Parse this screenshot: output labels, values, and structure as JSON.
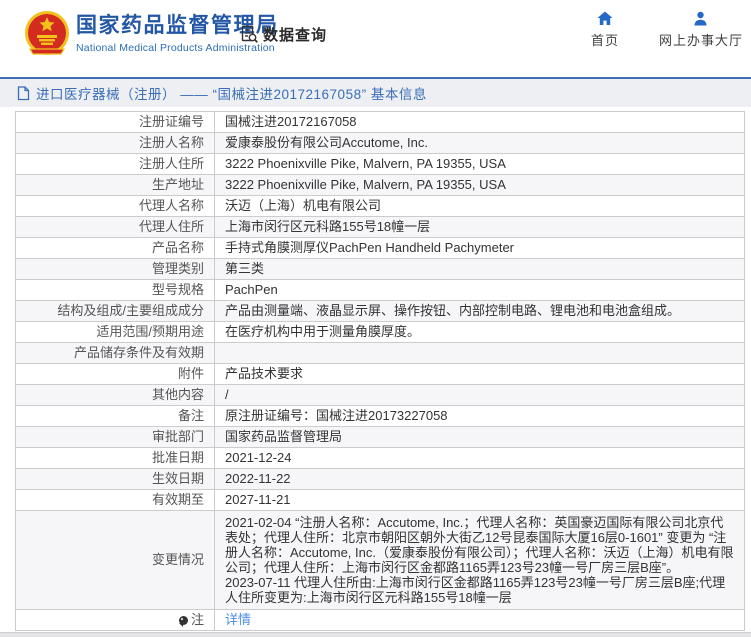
{
  "header": {
    "agency_name_cn": "国家药品监督管理局",
    "agency_name_en": "National Medical Products Administration",
    "data_query_label": "数据查询",
    "nav": [
      {
        "label": "首页",
        "icon": "home-icon"
      },
      {
        "label": "网上办事大厅",
        "icon": "person-icon"
      }
    ]
  },
  "breadcrumb": {
    "text": "进口医疗器械（注册） —— “国械注进20172167058” 基本信息",
    "icon": "page-icon"
  },
  "table": {
    "rows": [
      {
        "label": "注册证编号",
        "value": "国械注进20172167058"
      },
      {
        "label": "注册人名称",
        "value": "爱康泰股份有限公司Accutome, Inc."
      },
      {
        "label": "注册人住所",
        "value": "3222 Phoenixville Pike, Malvern, PA 19355, USA"
      },
      {
        "label": "生产地址",
        "value": "3222 Phoenixville Pike, Malvern, PA 19355, USA"
      },
      {
        "label": "代理人名称",
        "value": "沃迈（上海）机电有限公司"
      },
      {
        "label": "代理人住所",
        "value": "上海市闵行区元科路155号18幢一层"
      },
      {
        "label": "产品名称",
        "value": "手持式角膜测厚仪PachPen Handheld Pachymeter"
      },
      {
        "label": "管理类别",
        "value": "第三类"
      },
      {
        "label": "型号规格",
        "value": "PachPen"
      },
      {
        "label": "结构及组成/主要组成成分",
        "value": "产品由测量端、液晶显示屏、操作按钮、内部控制电路、锂电池和电池盒组成。"
      },
      {
        "label": "适用范围/预期用途",
        "value": "在医疗机构中用于测量角膜厚度。"
      },
      {
        "label": "产品储存条件及有效期",
        "value": ""
      },
      {
        "label": "附件",
        "value": "产品技术要求"
      },
      {
        "label": "其他内容",
        "value": "/"
      },
      {
        "label": "备注",
        "value": "原注册证编号：国械注进20173227058"
      },
      {
        "label": "审批部门",
        "value": "国家药品监督管理局"
      },
      {
        "label": "批准日期",
        "value": "2021-12-24"
      },
      {
        "label": "生效日期",
        "value": "2022-11-22"
      },
      {
        "label": "有效期至",
        "value": "2027-11-21"
      },
      {
        "label": "变更情况",
        "paragraphs": [
          "2021-02-04 “注册人名称：Accutome, Inc.；代理人名称：英国豪迈国际有限公司北京代表处；代理人住所：北京市朝阳区朝外大街乙12号昆泰国际大厦16层0-1601” 变更为 “注册人名称：Accutome, Inc.（爱康泰股份有限公司）；代理人名称：沃迈（上海）机电有限公司；代理人住所：上海市闵行区金都路1165弄123号23幢一号厂房三层B座”。",
          "2023-07-11 代理人住所由:上海市闵行区金都路1165弄123号23幢一号厂房三层B座;代理人住所变更为:上海市闵行区元科路155号18幢一层"
        ]
      },
      {
        "label": "注",
        "icon": "note-icon",
        "value": "详情",
        "link": true
      }
    ]
  },
  "colors": {
    "brand_blue": "#2357a6",
    "nav_icon_blue": "#2468c8",
    "breadcrumb_text_blue": "#3a6db8",
    "link_blue": "#4b8ee0",
    "row_alt_bg": "#f6f6f8",
    "table_border": "#cccccc",
    "emblem_red": "#d42b21",
    "emblem_gold": "#f2c11c"
  }
}
